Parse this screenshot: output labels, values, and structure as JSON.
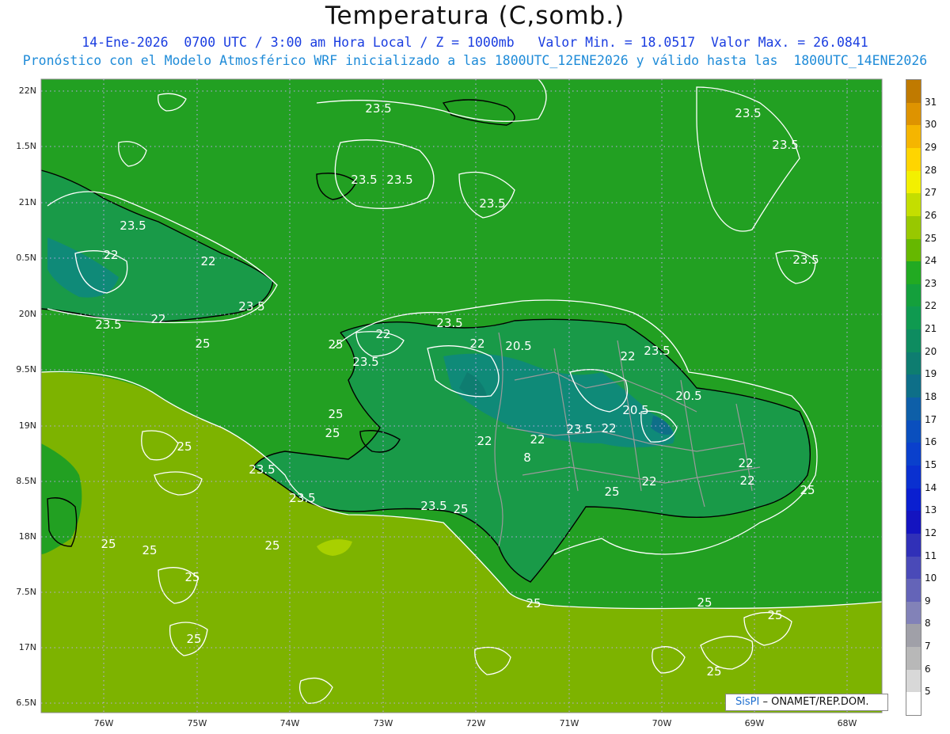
{
  "title": "Temperatura (C,somb.)",
  "subtitle_line1": "14-Ene-2026  0700 UTC / 3:00 am Hora Local / Z = 1000mb   Valor Min. = 18.0517  Valor Max. = 26.0841",
  "subtitle_line2": "Pronóstico con el Modelo Atmosférico WRF inicializado a las 1800UTC_12ENE2026 y válido hasta las  1800UTC_14ENE2026",
  "lat_labels": [
    "22N",
    "1.5N",
    "21N",
    "0.5N",
    "20N",
    "9.5N",
    "19N",
    "8.5N",
    "18N",
    "7.5N",
    "17N",
    "6.5N"
  ],
  "lon_labels": [
    "76W",
    "75W",
    "74W",
    "73W",
    "72W",
    "71W",
    "70W",
    "69W",
    "68W"
  ],
  "colorbar": {
    "labels": [
      "31",
      "30",
      "29",
      "28",
      "27",
      "26",
      "25",
      "24",
      "23",
      "22",
      "21",
      "20",
      "19",
      "18",
      "17",
      "16",
      "15",
      "14",
      "13",
      "12",
      "11",
      "10",
      "9",
      "8",
      "7",
      "6",
      "5"
    ],
    "colors": [
      "#c07a00",
      "#de9300",
      "#f5b500",
      "#ffd500",
      "#f3f000",
      "#c4de00",
      "#98c800",
      "#66b800",
      "#22aa22",
      "#14a03c",
      "#0f9a50",
      "#0e8c60",
      "#0e7d70",
      "#0e6f88",
      "#0e5fa8",
      "#0a4fbe",
      "#0a40cc",
      "#0a30d0",
      "#0a1fd0",
      "#1414c0",
      "#3030b8",
      "#4a4ab8",
      "#6464b8",
      "#8282b8",
      "#a0a0a8",
      "#b8b8b8",
      "#d8d8d8",
      "#ffffff"
    ]
  },
  "map": {
    "contour_labels": [
      "23.5",
      "23.5",
      "23.5",
      "23.5",
      "23.5",
      "23.5",
      "23.5",
      "23.5",
      "23.5",
      "23.5",
      "23.5",
      "23.5",
      "23.5",
      "23.5",
      "23.5",
      "23.5",
      "23.5",
      "22",
      "22",
      "22",
      "22",
      "22",
      "22",
      "22",
      "22",
      "22",
      "22",
      "22",
      "22",
      "20.5",
      "20.5",
      "20.5",
      "25",
      "25",
      "25",
      "25",
      "25",
      "25",
      "25",
      "25",
      "25",
      "25",
      "25",
      "25",
      "25",
      "25",
      "25",
      "25",
      "25",
      "8"
    ],
    "colors": {
      "sea_warm": "#7db300",
      "sea_mid": "#22a022",
      "land_cool": "#199a48",
      "land_cold": "#0f8a78",
      "contour": "#ffffff",
      "coast": "#000000",
      "border": "#9a9a9a"
    }
  },
  "credit": {
    "brand": "SisPI",
    "text": "– ONAMET/REP.DOM."
  }
}
